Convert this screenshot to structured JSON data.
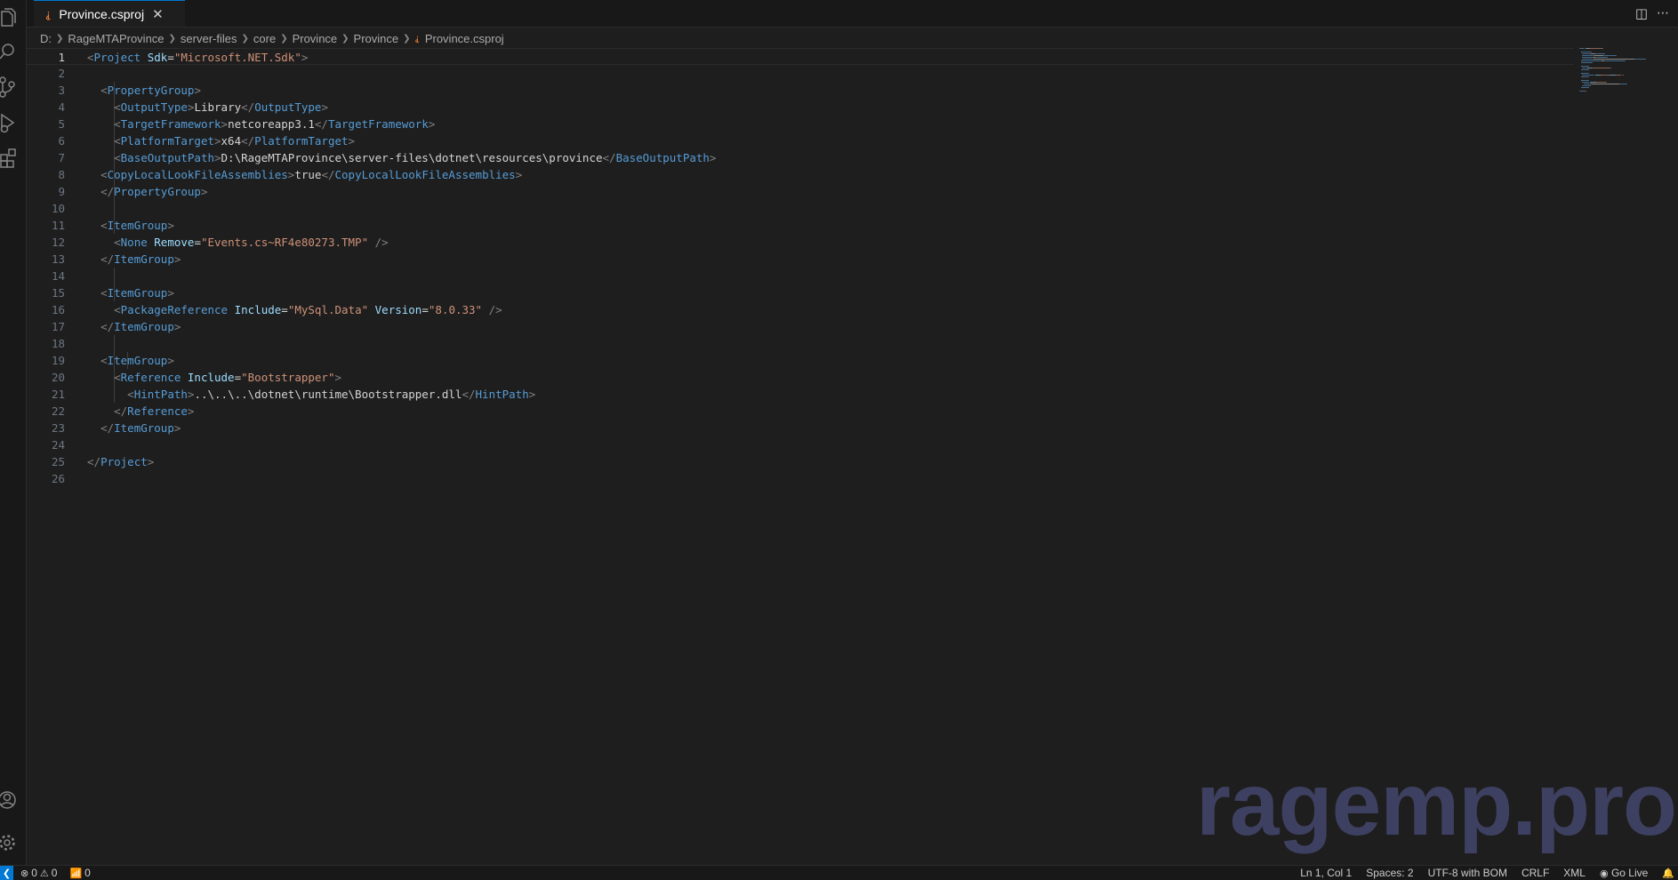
{
  "tab": {
    "label": "Province.csproj"
  },
  "breadcrumb": [
    "D:",
    "RageMTAProvince",
    "server-files",
    "core",
    "Province",
    "Province",
    "Province.csproj"
  ],
  "editor": {
    "current_line": 1,
    "lines": [
      [
        [
          "b",
          "<"
        ],
        [
          "t",
          "Project"
        ],
        [
          "x",
          " "
        ],
        [
          "a",
          "Sdk"
        ],
        [
          "x",
          "="
        ],
        [
          "s",
          "\"Microsoft.NET.Sdk\""
        ],
        [
          "b",
          ">"
        ]
      ],
      [],
      [
        [
          "x",
          "  "
        ],
        [
          "b",
          "<"
        ],
        [
          "t",
          "PropertyGroup"
        ],
        [
          "b",
          ">"
        ]
      ],
      [
        [
          "x",
          "    "
        ],
        [
          "b",
          "<"
        ],
        [
          "t",
          "OutputType"
        ],
        [
          "b",
          ">"
        ],
        [
          "x",
          "Library"
        ],
        [
          "b",
          "</"
        ],
        [
          "t",
          "OutputType"
        ],
        [
          "b",
          ">"
        ]
      ],
      [
        [
          "x",
          "    "
        ],
        [
          "b",
          "<"
        ],
        [
          "t",
          "TargetFramework"
        ],
        [
          "b",
          ">"
        ],
        [
          "x",
          "netcoreapp3.1"
        ],
        [
          "b",
          "</"
        ],
        [
          "t",
          "TargetFramework"
        ],
        [
          "b",
          ">"
        ]
      ],
      [
        [
          "x",
          "    "
        ],
        [
          "b",
          "<"
        ],
        [
          "t",
          "PlatformTarget"
        ],
        [
          "b",
          ">"
        ],
        [
          "x",
          "x64"
        ],
        [
          "b",
          "</"
        ],
        [
          "t",
          "PlatformTarget"
        ],
        [
          "b",
          ">"
        ]
      ],
      [
        [
          "x",
          "    "
        ],
        [
          "b",
          "<"
        ],
        [
          "t",
          "BaseOutputPath"
        ],
        [
          "b",
          ">"
        ],
        [
          "x",
          "D:\\RageMTAProvince\\server-files\\dotnet\\resources\\province"
        ],
        [
          "b",
          "</"
        ],
        [
          "t",
          "BaseOutputPath"
        ],
        [
          "b",
          ">"
        ]
      ],
      [
        [
          "x",
          "  "
        ],
        [
          "b",
          "<"
        ],
        [
          "t",
          "CopyLocalLookFileAssemblies"
        ],
        [
          "b",
          ">"
        ],
        [
          "x",
          "true"
        ],
        [
          "b",
          "</"
        ],
        [
          "t",
          "CopyLocalLookFileAssemblies"
        ],
        [
          "b",
          ">"
        ]
      ],
      [
        [
          "x",
          "  "
        ],
        [
          "b",
          "</"
        ],
        [
          "t",
          "PropertyGroup"
        ],
        [
          "b",
          ">"
        ]
      ],
      [],
      [
        [
          "x",
          "  "
        ],
        [
          "b",
          "<"
        ],
        [
          "t",
          "ItemGroup"
        ],
        [
          "b",
          ">"
        ]
      ],
      [
        [
          "x",
          "    "
        ],
        [
          "b",
          "<"
        ],
        [
          "t",
          "None"
        ],
        [
          "x",
          " "
        ],
        [
          "a",
          "Remove"
        ],
        [
          "x",
          "="
        ],
        [
          "s",
          "\"Events.cs~RF4e80273.TMP\""
        ],
        [
          "x",
          " "
        ],
        [
          "b",
          "/>"
        ]
      ],
      [
        [
          "x",
          "  "
        ],
        [
          "b",
          "</"
        ],
        [
          "t",
          "ItemGroup"
        ],
        [
          "b",
          ">"
        ]
      ],
      [],
      [
        [
          "x",
          "  "
        ],
        [
          "b",
          "<"
        ],
        [
          "t",
          "ItemGroup"
        ],
        [
          "b",
          ">"
        ]
      ],
      [
        [
          "x",
          "    "
        ],
        [
          "b",
          "<"
        ],
        [
          "t",
          "PackageReference"
        ],
        [
          "x",
          " "
        ],
        [
          "a",
          "Include"
        ],
        [
          "x",
          "="
        ],
        [
          "s",
          "\"MySql.Data\""
        ],
        [
          "x",
          " "
        ],
        [
          "a",
          "Version"
        ],
        [
          "x",
          "="
        ],
        [
          "s",
          "\"8.0.33\""
        ],
        [
          "x",
          " "
        ],
        [
          "b",
          "/>"
        ]
      ],
      [
        [
          "x",
          "  "
        ],
        [
          "b",
          "</"
        ],
        [
          "t",
          "ItemGroup"
        ],
        [
          "b",
          ">"
        ]
      ],
      [],
      [
        [
          "x",
          "  "
        ],
        [
          "b",
          "<"
        ],
        [
          "t",
          "ItemGroup"
        ],
        [
          "b",
          ">"
        ]
      ],
      [
        [
          "x",
          "    "
        ],
        [
          "b",
          "<"
        ],
        [
          "t",
          "Reference"
        ],
        [
          "x",
          " "
        ],
        [
          "a",
          "Include"
        ],
        [
          "x",
          "="
        ],
        [
          "s",
          "\"Bootstrapper\""
        ],
        [
          "b",
          ">"
        ]
      ],
      [
        [
          "x",
          "      "
        ],
        [
          "b",
          "<"
        ],
        [
          "t",
          "HintPath"
        ],
        [
          "b",
          ">"
        ],
        [
          "x",
          "..\\..\\..\\dotnet\\runtime\\Bootstrapper.dll"
        ],
        [
          "b",
          "</"
        ],
        [
          "t",
          "HintPath"
        ],
        [
          "b",
          ">"
        ]
      ],
      [
        [
          "x",
          "    "
        ],
        [
          "b",
          "</"
        ],
        [
          "t",
          "Reference"
        ],
        [
          "b",
          ">"
        ]
      ],
      [
        [
          "x",
          "  "
        ],
        [
          "b",
          "</"
        ],
        [
          "t",
          "ItemGroup"
        ],
        [
          "b",
          ">"
        ]
      ],
      [],
      [
        [
          "b",
          "</"
        ],
        [
          "t",
          "Project"
        ],
        [
          "b",
          ">"
        ]
      ],
      []
    ]
  },
  "watermark": "ragemp.pro",
  "status": {
    "errors": "0",
    "warnings": "0",
    "ports": "0",
    "position": "Ln 1, Col 1",
    "spaces": "Spaces: 2",
    "encoding": "UTF-8 with BOM",
    "eol": "CRLF",
    "language": "XML",
    "golive": "Go Live"
  },
  "colors": {
    "background": "#1e1e1e",
    "tag": "#569cd6",
    "bracket": "#808080",
    "attribute": "#9cdcfe",
    "string": "#ce9178",
    "accent": "#0078d4"
  }
}
